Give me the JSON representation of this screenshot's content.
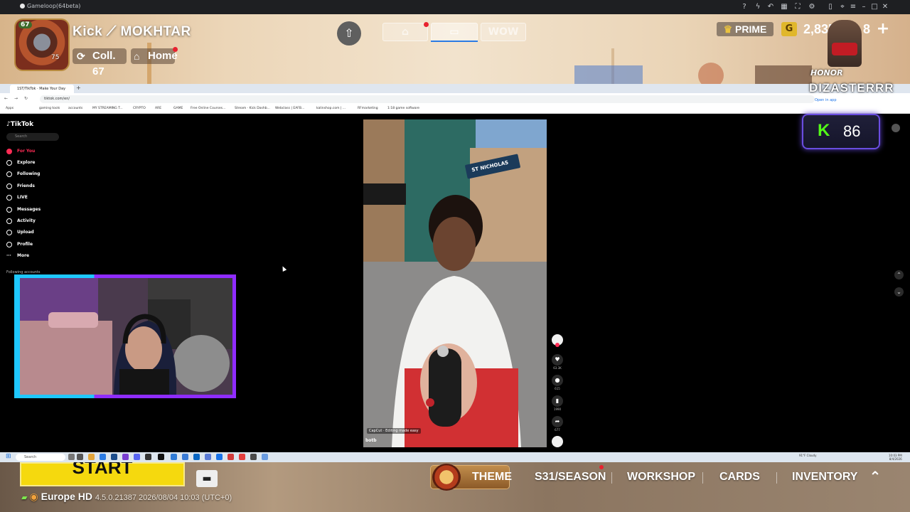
{
  "colors": {
    "tiktok_red": "#fe2c55",
    "kick_green": "#53fc18",
    "start_yellow": "#f5d90e",
    "webcam_cyan": "#1ec8ff",
    "webcam_purple": "#8f2cff"
  },
  "gameloop": {
    "title": "Gameloop(64beta)",
    "icons": [
      "help-icon",
      "bolt-icon",
      "history-icon",
      "grid-icon",
      "fullscreen-icon",
      "settings-icon",
      "sidebar-icon",
      "pin-icon",
      "menu-icon",
      "minimize-icon",
      "maximize-icon",
      "close-icon"
    ]
  },
  "lobby": {
    "avatar_level": "67",
    "avatar_sub": "75",
    "player_name": "Kick ⟋ MOKHTAR",
    "collection": "Coll. 67",
    "home": "Home",
    "mode_tabs": [
      "",
      "",
      "WOW"
    ],
    "prime": "PRIME",
    "currency_icon": "G",
    "currency": "2,835",
    "plus_count": "8",
    "plus": "+",
    "honor": "HONOR"
  },
  "browser": {
    "tab_title": "1ST/TikTok · Make Your Day",
    "new_tab": "+",
    "url": "tiktok.com/en/",
    "open_in": "Open in app",
    "streamer": "DIZASTERRR",
    "bookmarks": [
      "Apps",
      "gaming tools",
      "accounts",
      "MY STREAMING T...",
      "CRYPTO",
      "ARE",
      "GAME",
      "Free Online Courses...",
      "Stream · Kick Dashb...",
      "Webclass | EAFB...",
      "kalinshop.com | ...",
      "RFmarketing",
      "1:18 game software"
    ]
  },
  "tiktok": {
    "logo": "TikTok",
    "search_placeholder": "Search",
    "nav": [
      {
        "label": "For You"
      },
      {
        "label": "Explore"
      },
      {
        "label": "Following"
      },
      {
        "label": "Friends"
      },
      {
        "label": "LIVE"
      },
      {
        "label": "Messages"
      },
      {
        "label": "Activity"
      },
      {
        "label": "Upload"
      },
      {
        "label": "Profile"
      },
      {
        "label": "More"
      }
    ],
    "following_accounts": "Following accounts",
    "video": {
      "sign": "ST NICHOLAS",
      "capcut": "CapCut · Editing made easy",
      "user": "botb"
    },
    "actions": [
      {
        "icon": "avatar-icon",
        "count": ""
      },
      {
        "icon": "heart-icon",
        "count": "63.3K"
      },
      {
        "icon": "comment-icon",
        "count": "615"
      },
      {
        "icon": "bookmark-icon",
        "count": "1990"
      },
      {
        "icon": "share-icon",
        "count": "677"
      }
    ]
  },
  "kick_badge": {
    "letter": "K",
    "count": "86"
  },
  "taskbar": {
    "search": "Search",
    "weather": "91°F Cloudy",
    "time": "10:03 PM",
    "date": "8/4/2026"
  },
  "bottom": {
    "start": "START",
    "server": "Europe HD",
    "version": "4.5.0.21387 2026/08/04 10:03 (UTC+0)",
    "theme": "THEME",
    "tabs": [
      "S31/SEASON",
      "WORKSHOP",
      "CARDS",
      "INVENTORY"
    ]
  }
}
